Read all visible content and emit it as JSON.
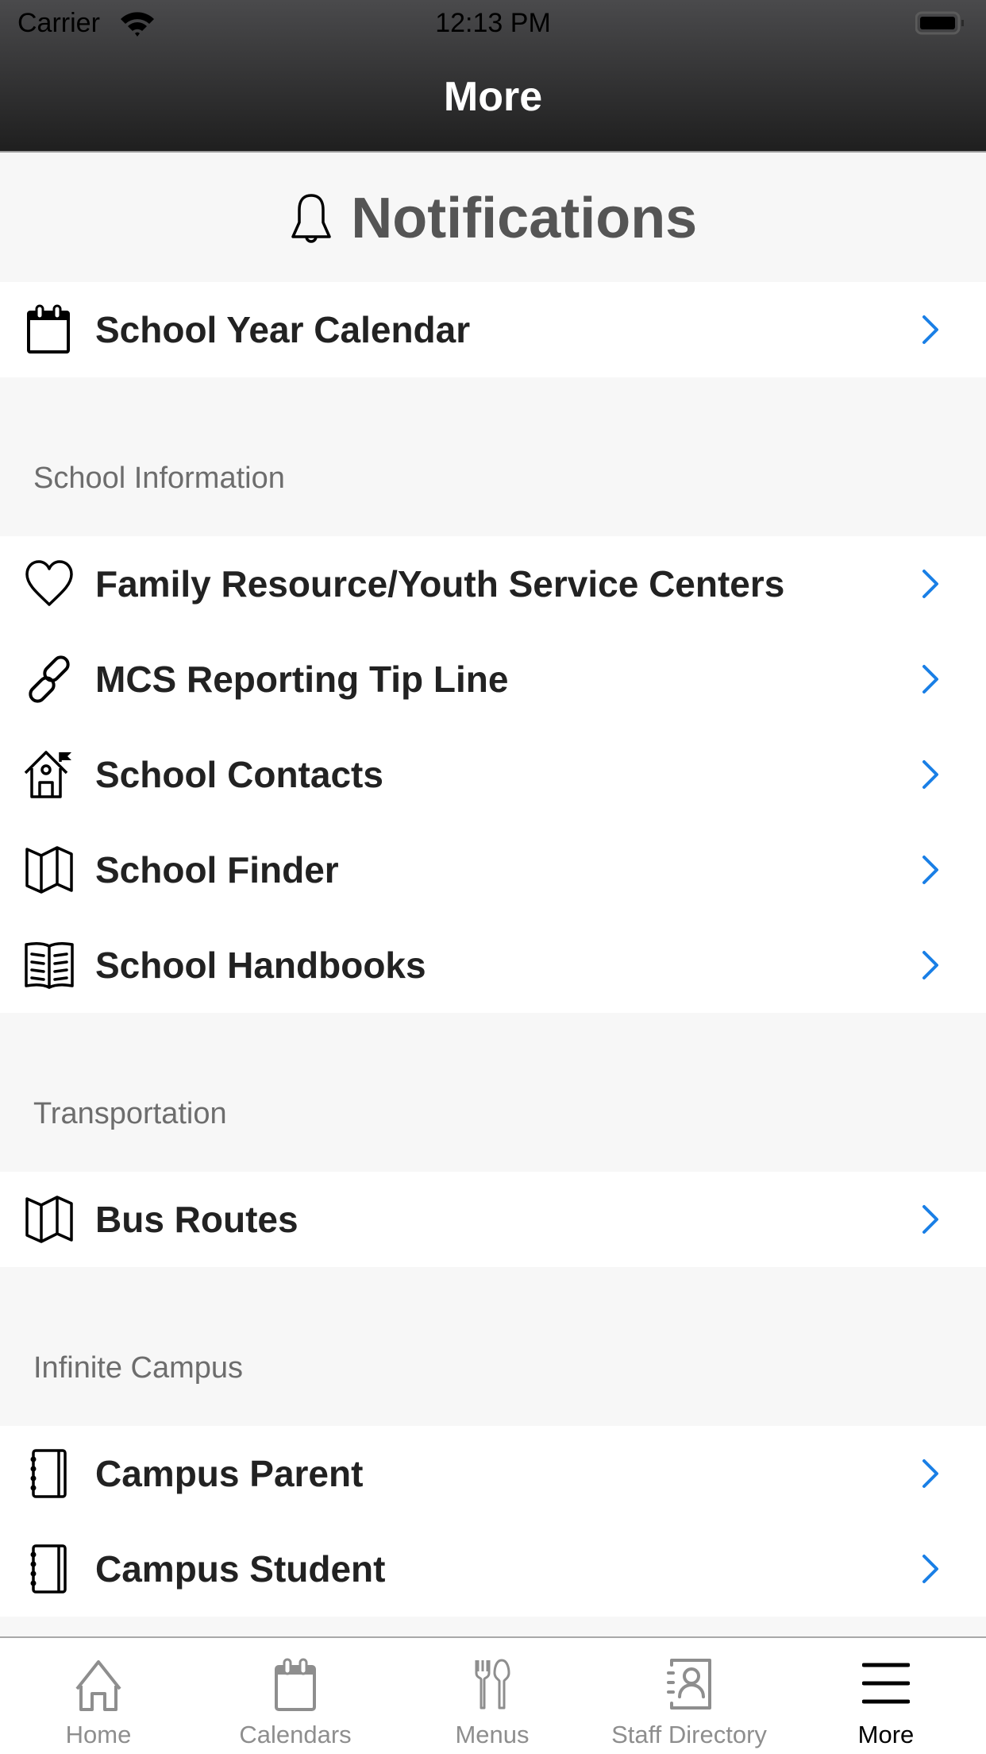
{
  "status_bar": {
    "carrier": "Carrier",
    "time": "12:13 PM"
  },
  "nav": {
    "title": "More"
  },
  "notifications": {
    "label": "Notifications",
    "icon": "bell-icon"
  },
  "top_items": [
    {
      "label": "School Year Calendar",
      "icon": "calendar-icon"
    }
  ],
  "sections": [
    {
      "title": "School Information",
      "items": [
        {
          "label": "Family Resource/Youth Service Centers",
          "icon": "heart-icon"
        },
        {
          "label": "MCS Reporting Tip Line",
          "icon": "link-icon"
        },
        {
          "label": "School Contacts",
          "icon": "school-house-icon"
        },
        {
          "label": "School Finder",
          "icon": "map-icon"
        },
        {
          "label": "School Handbooks",
          "icon": "book-icon"
        }
      ]
    },
    {
      "title": "Transportation",
      "items": [
        {
          "label": "Bus Routes",
          "icon": "map-icon"
        }
      ]
    },
    {
      "title": "Infinite Campus",
      "items": [
        {
          "label": "Campus Parent",
          "icon": "notebook-icon"
        },
        {
          "label": "Campus Student",
          "icon": "notebook-icon"
        }
      ]
    }
  ],
  "tab_bar": {
    "tabs": [
      {
        "label": "Home",
        "icon": "home-icon",
        "active": false
      },
      {
        "label": "Calendars",
        "icon": "calendar-icon",
        "active": false
      },
      {
        "label": "Menus",
        "icon": "fork-spoon-icon",
        "active": false
      },
      {
        "label": "Staff Directory",
        "icon": "contact-book-icon",
        "active": false
      },
      {
        "label": "More",
        "icon": "hamburger-menu-icon",
        "active": true
      }
    ]
  },
  "colors": {
    "accent": "#1a7fe6",
    "active_tab": "#000000",
    "inactive_tab": "#8e8e8e"
  }
}
